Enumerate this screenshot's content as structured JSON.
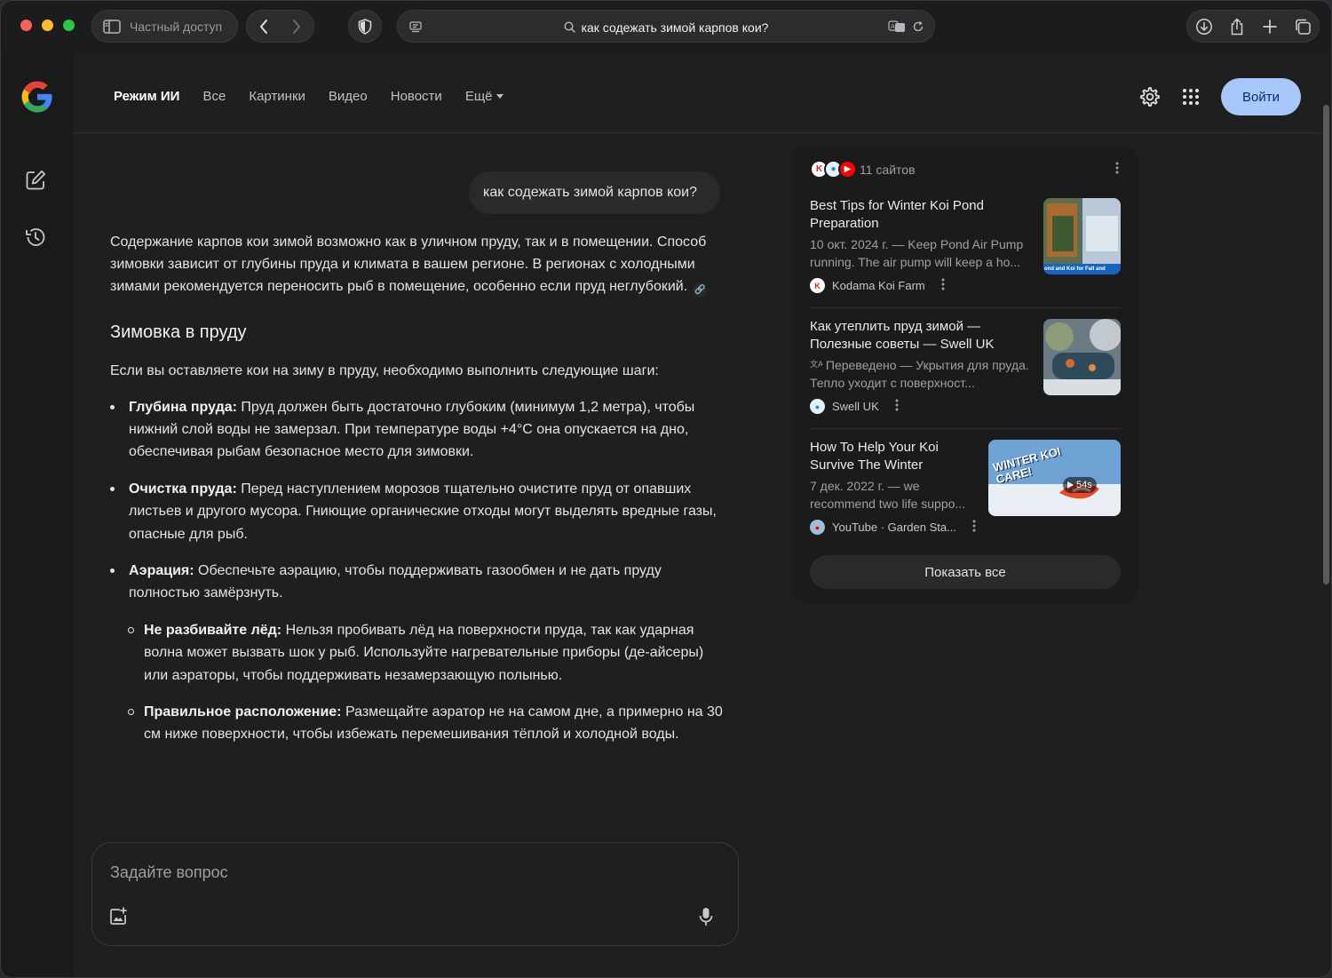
{
  "browser": {
    "private_label": "Частный доступ",
    "url_text": "как содежать зимой карпов кои?"
  },
  "header": {
    "tabs": [
      {
        "label": "Режим ИИ"
      },
      {
        "label": "Все"
      },
      {
        "label": "Картинки"
      },
      {
        "label": "Видео"
      },
      {
        "label": "Новости"
      },
      {
        "label": "Ещё"
      }
    ],
    "signin_label": "Войти"
  },
  "chat": {
    "user_query": "как содежать зимой карпов кои?",
    "intro": "Содержание карпов кои зимой возможно как в уличном пруду, так и в помещении. Способ зимовки зависит от глубины пруда и климата в вашем регионе. В регионах с холодными зимами рекомендуется переносить рыб в помещение, особенно если пруд неглубокий.",
    "heading": "Зимовка в пруду",
    "lead": "Если вы оставляете кои на зиму в пруду, необходимо выполнить следующие шаги:",
    "bullets": [
      {
        "title": "Глубина пруда:",
        "text": " Пруд должен быть достаточно глубоким (минимум 1,2 метра), чтобы нижний слой воды не замерзал. При температуре воды +4°C она опускается на дно, обеспечивая рыбам безопасное место для зимовки."
      },
      {
        "title": "Очистка пруда:",
        "text": " Перед наступлением морозов тщательно очистите пруд от опавших листьев и другого мусора. Гниющие органические отходы могут выделять вредные газы, опасные для рыб."
      },
      {
        "title": "Аэрация:",
        "text": " Обеспечьте аэрацию, чтобы поддерживать газообмен и не дать пруду полностью замёрзнуть."
      }
    ],
    "sub_bullets": [
      {
        "title": "Не разбивайте лёд:",
        "text": " Нельзя пробивать лёд на поверхности пруда, так как ударная волна может вызвать шок у рыб. Используйте нагревательные приборы (де-айсеры) или аэраторы, чтобы поддерживать незамерзающую полынью."
      },
      {
        "title": "Правильное расположение:",
        "text": " Размещайте аэратор не на самом дне, а примерно на 30 см ниже поверхности, чтобы избежать перемешивания тёплой и холодной воды."
      }
    ]
  },
  "composer": {
    "placeholder": "Задайте вопрос"
  },
  "sources": {
    "count_label": "11 сайтов",
    "items": [
      {
        "title": "Best Tips for Winter Koi Pond Preparation",
        "snippet": "10 окт. 2024 г. — Keep Pond Air Pump running. The air pump will keep a ho...",
        "site": "Kodama Koi Farm",
        "thumb_caption": "ond and Koi for Fall and"
      },
      {
        "title": "Как утеплить пруд зимой — Полезные советы — Swell UK",
        "snippet": "Переведено — Укрытия для пруда. Тепло уходит с поверхност...",
        "site": "Swell UK"
      },
      {
        "title": "How To Help Your Koi Survive The Winter",
        "snippet": "7 дек. 2022 г. — we recommend two life suppo...",
        "site": "YouTube · Garden Sta...",
        "thumb_caption": "WINTER KOI CARE!",
        "duration": "54s"
      }
    ],
    "show_all_label": "Показать все"
  },
  "colors": {
    "accent": "#a8c7fa",
    "background": "#1f1f1f"
  }
}
